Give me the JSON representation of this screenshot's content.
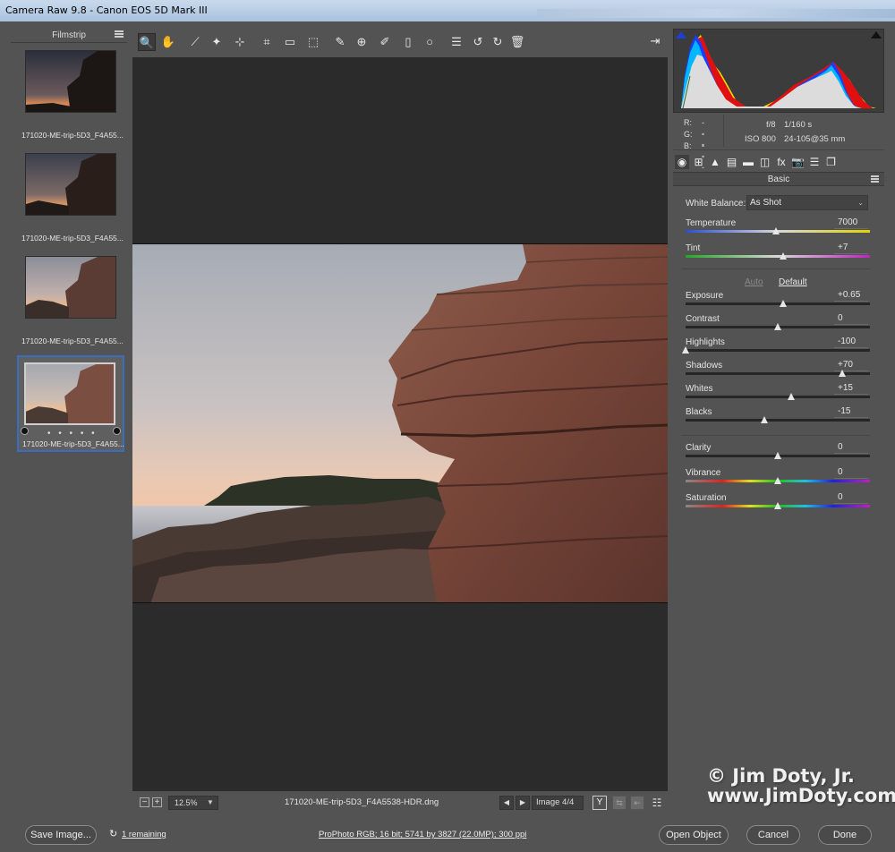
{
  "window": {
    "title": "Camera Raw 9.8  -  Canon EOS 5D Mark III"
  },
  "filmstrip": {
    "title": "Filmstrip",
    "items": [
      {
        "caption": "171020-ME-trip-5D3_F4A55..."
      },
      {
        "caption": "171020-ME-trip-5D3_F4A55..."
      },
      {
        "caption": "171020-ME-trip-5D3_F4A55..."
      },
      {
        "caption": "171020-ME-trip-5D3_F4A55...",
        "selected": true
      }
    ],
    "selected_dots": "• • • • •"
  },
  "toolbar": {
    "tools": [
      {
        "name": "zoom-tool-icon",
        "glyph": "🔍"
      },
      {
        "name": "hand-tool-icon",
        "glyph": "✋"
      },
      {
        "name": "white-balance-tool-icon",
        "glyph": "⟋"
      },
      {
        "name": "color-sampler-tool-icon",
        "glyph": "✦"
      },
      {
        "name": "targeted-adjustment-tool-icon",
        "glyph": "⊹"
      },
      {
        "name": "crop-tool-icon",
        "glyph": "⌗"
      },
      {
        "name": "straighten-tool-icon",
        "glyph": "▭"
      },
      {
        "name": "transform-tool-icon",
        "glyph": "⬚"
      },
      {
        "name": "spot-removal-tool-icon",
        "glyph": "✎"
      },
      {
        "name": "red-eye-removal-icon",
        "glyph": "⊕"
      },
      {
        "name": "adjustment-brush-icon",
        "glyph": "✐"
      },
      {
        "name": "graduated-filter-icon",
        "glyph": "▯"
      },
      {
        "name": "radial-filter-icon",
        "glyph": "○"
      },
      {
        "name": "preferences-list-icon",
        "glyph": "☰"
      },
      {
        "name": "rotate-left-icon",
        "glyph": "↺"
      },
      {
        "name": "rotate-right-icon",
        "glyph": "↻"
      },
      {
        "name": "trash-icon",
        "glyph": "🗑"
      }
    ],
    "export_glyph": "⇥"
  },
  "canvas_bar": {
    "zoom_out": "−",
    "zoom_in": "+",
    "zoom_value": "12.5%",
    "zoom_dropdown": "▼",
    "filename": "171020-ME-trip-5D3_F4A5538-HDR.dng",
    "prev": "◀",
    "next": "▶",
    "image_count": "Image 4/4",
    "y_button": "Y",
    "ghost1": "⇆",
    "ghost2": "⇤",
    "prefs_glyph": "☷"
  },
  "histogram": {
    "rgb": {
      "r_label": "R:",
      "g_label": "G:",
      "b_label": "B:",
      "r": "---",
      "g": "---",
      "b": "---"
    },
    "exif": {
      "aperture": "f/8",
      "shutter": "1/160 s",
      "iso": "ISO 800",
      "lens": "24-105@35 mm"
    }
  },
  "panel_tabs": [
    "◉",
    "⊞",
    "▲",
    "▤",
    "▬",
    "◫",
    "fx",
    "📷",
    "☰",
    "❐"
  ],
  "basic": {
    "title": "Basic",
    "white_balance_label": "White Balance:",
    "white_balance_value": "As Shot",
    "white_balance_chev": "⌄",
    "auto_label": "Auto",
    "default_label": "Default",
    "sliders": [
      {
        "key": "temperature",
        "label": "Temperature",
        "value": "7000",
        "pos": 0.49,
        "track": "temp"
      },
      {
        "key": "tint",
        "label": "Tint",
        "value": "+7",
        "pos": 0.53,
        "track": "tint"
      },
      {
        "key": "exposure",
        "label": "Exposure",
        "value": "+0.65",
        "pos": 0.53,
        "track": "plain"
      },
      {
        "key": "contrast",
        "label": "Contrast",
        "value": "0",
        "pos": 0.5,
        "track": "plain"
      },
      {
        "key": "highlights",
        "label": "Highlights",
        "value": "-100",
        "pos": 0.0,
        "track": "plain"
      },
      {
        "key": "shadows",
        "label": "Shadows",
        "value": "+70",
        "pos": 0.85,
        "track": "plain"
      },
      {
        "key": "whites",
        "label": "Whites",
        "value": "+15",
        "pos": 0.575,
        "track": "plain"
      },
      {
        "key": "blacks",
        "label": "Blacks",
        "value": "-15",
        "pos": 0.425,
        "track": "plain"
      },
      {
        "key": "clarity",
        "label": "Clarity",
        "value": "0",
        "pos": 0.5,
        "track": "plain"
      },
      {
        "key": "vibrance",
        "label": "Vibrance",
        "value": "0",
        "pos": 0.5,
        "track": "sat"
      },
      {
        "key": "saturation",
        "label": "Saturation",
        "value": "0",
        "pos": 0.5,
        "track": "sat"
      }
    ]
  },
  "watermark": {
    "line1": "© Jim Doty, Jr.",
    "line2": "www.JimDoty.com"
  },
  "footer": {
    "save_image": "Save Image...",
    "remaining_icon": "↻",
    "remaining": "1 remaining",
    "workflow": "ProPhoto RGB; 16 bit; 5741 by 3827 (22.0MP); 300 ppi",
    "open_object": "Open Object",
    "cancel": "Cancel",
    "done": "Done"
  },
  "colors": {
    "accent_selection": "#3a6ebd",
    "panel_bg": "#535353",
    "canvas_bg": "#2b2b2b"
  }
}
